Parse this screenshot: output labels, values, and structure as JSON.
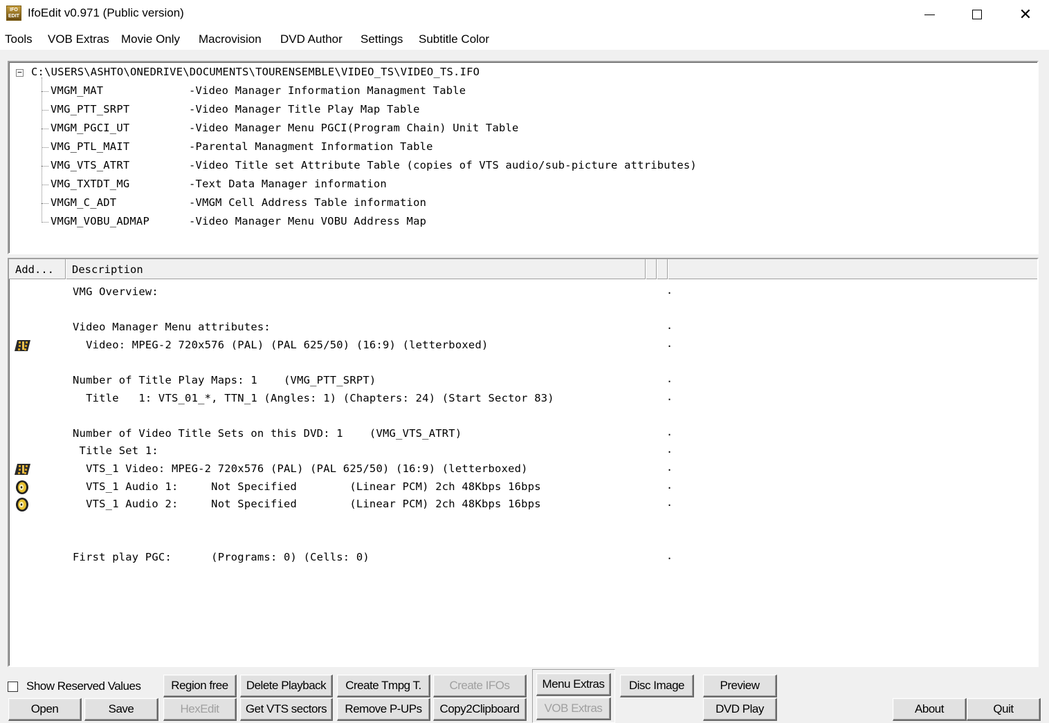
{
  "window": {
    "title": "IfoEdit v0.971 (Public version)",
    "icon_text": "IFO EDIT"
  },
  "menu": [
    "Tools",
    "VOB Extras",
    "Movie Only",
    "Macrovision",
    "DVD Author",
    "Settings",
    "Subtitle Color"
  ],
  "tree": {
    "root": "C:\\USERS\\ASHTO\\ONEDRIVE\\DOCUMENTS\\TOURENSEMBLE\\VIDEO_TS\\VIDEO_TS.IFO",
    "nodes": [
      {
        "name": "VMGM_MAT",
        "desc": "-Video Manager Information Managment Table"
      },
      {
        "name": "VMG_PTT_SRPT",
        "desc": "-Video Manager Title Play Map Table"
      },
      {
        "name": "VMGM_PGCI_UT",
        "desc": "-Video Manager Menu PGCI(Program Chain) Unit Table"
      },
      {
        "name": "VMG_PTL_MAIT",
        "desc": "-Parental Managment Information Table"
      },
      {
        "name": "VMG_VTS_ATRT",
        "desc": "-Video Title set Attribute Table (copies of VTS audio/sub-picture attributes)"
      },
      {
        "name": "VMG_TXTDT_MG",
        "desc": "-Text Data Manager information"
      },
      {
        "name": "VMGM_C_ADT",
        "desc": "-VMGM Cell Address Table information"
      },
      {
        "name": "VMGM_VOBU_ADMAP",
        "desc": "-Video Manager Menu VOBU Address Map"
      }
    ]
  },
  "list": {
    "headers": {
      "add": "Add...",
      "description": "Description"
    },
    "rows": [
      {
        "text": "VMG Overview:",
        "icon": "",
        "dot": "."
      },
      {
        "text": "",
        "icon": "",
        "dot": ""
      },
      {
        "text": "Video Manager Menu attributes:",
        "icon": "",
        "dot": "."
      },
      {
        "text": "  Video: MPEG-2 720x576 (PAL) (PAL 625/50) (16:9) (letterboxed)",
        "icon": "video-icon",
        "dot": "."
      },
      {
        "text": "",
        "icon": "",
        "dot": ""
      },
      {
        "text": "Number of Title Play Maps: 1    (VMG_PTT_SRPT)",
        "icon": "",
        "dot": "."
      },
      {
        "text": "  Title   1: VTS_01_*, TTN_1 (Angles: 1) (Chapters: 24) (Start Sector 83)",
        "icon": "",
        "dot": "."
      },
      {
        "text": "",
        "icon": "",
        "dot": ""
      },
      {
        "text": "Number of Video Title Sets on this DVD: 1    (VMG_VTS_ATRT)",
        "icon": "",
        "dot": "."
      },
      {
        "text": " Title Set 1:",
        "icon": "",
        "dot": "."
      },
      {
        "text": "  VTS_1 Video: MPEG-2 720x576 (PAL) (PAL 625/50) (16:9) (letterboxed)",
        "icon": "video-icon",
        "dot": "."
      },
      {
        "text": "  VTS_1 Audio 1:     Not Specified        (Linear PCM) 2ch 48Kbps 16bps",
        "icon": "audio-icon",
        "dot": "."
      },
      {
        "text": "  VTS_1 Audio 2:     Not Specified        (Linear PCM) 2ch 48Kbps 16bps",
        "icon": "audio-icon",
        "dot": "."
      },
      {
        "text": "",
        "icon": "",
        "dot": ""
      },
      {
        "text": "",
        "icon": "",
        "dot": ""
      },
      {
        "text": "First play PGC:      (Programs: 0) (Cells: 0)",
        "icon": "",
        "dot": "."
      }
    ]
  },
  "controls": {
    "show_reserved_label": "Show Reserved Values",
    "show_reserved_checked": false,
    "buttons": {
      "open": "Open",
      "save": "Save",
      "region_free": "Region free",
      "hexedit": "HexEdit",
      "delete_playback": "Delete Playback",
      "get_vts_sectors": "Get VTS sectors",
      "create_tmpg": "Create Tmpg T.",
      "remove_pups": "Remove P-UPs",
      "create_ifos": "Create IFOs",
      "copy2clipboard": "Copy2Clipboard",
      "menu_extras": "Menu Extras",
      "vob_extras": "VOB Extras",
      "disc_image": "Disc Image",
      "preview": "Preview",
      "dvd_play": "DVD Play",
      "about": "About",
      "quit": "Quit"
    }
  }
}
